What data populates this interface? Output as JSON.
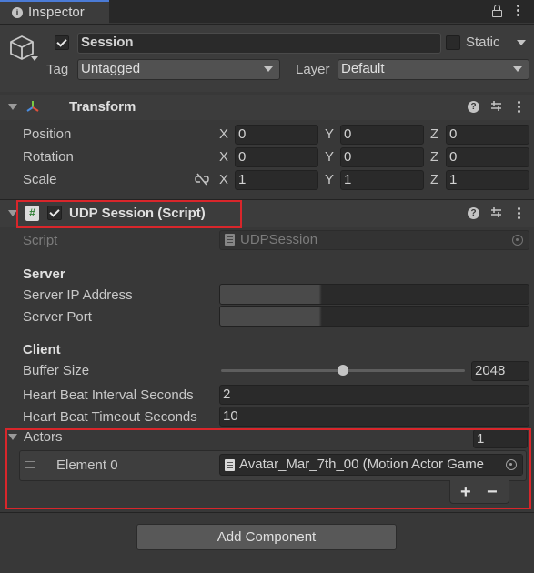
{
  "tab": {
    "title": "Inspector"
  },
  "object": {
    "name": "Session",
    "static_label": "Static",
    "tag_label": "Tag",
    "tag_value": "Untagged",
    "layer_label": "Layer",
    "layer_value": "Default"
  },
  "transform": {
    "title": "Transform",
    "rows": [
      {
        "label": "Position",
        "x": "0",
        "y": "0",
        "z": "0"
      },
      {
        "label": "Rotation",
        "x": "0",
        "y": "0",
        "z": "0"
      },
      {
        "label": "Scale",
        "x": "1",
        "y": "1",
        "z": "1"
      }
    ],
    "axis": {
      "x": "X",
      "y": "Y",
      "z": "Z"
    }
  },
  "udp": {
    "title": "UDP Session (Script)",
    "script_label": "Script",
    "script_value": "UDPSession",
    "server_header": "Server",
    "server_ip_label": "Server IP Address",
    "server_port_label": "Server Port",
    "client_header": "Client",
    "buffer_label": "Buffer Size",
    "buffer_value": "2048",
    "buffer_fraction": 0.5,
    "hb_interval_label": "Heart Beat Interval Seconds",
    "hb_interval_value": "2",
    "hb_timeout_label": "Heart Beat Timeout Seconds",
    "hb_timeout_value": "10",
    "actors_label": "Actors",
    "actors_count": "1",
    "element_label": "Element 0",
    "element_value": "Avatar_Mar_7th_00 (Motion Actor Game"
  },
  "buttons": {
    "plus": "+",
    "minus": "−",
    "add_component": "Add Component"
  },
  "colors": {
    "highlight": "#d9262b",
    "background": "#383838",
    "field": "#2a2a2a"
  }
}
